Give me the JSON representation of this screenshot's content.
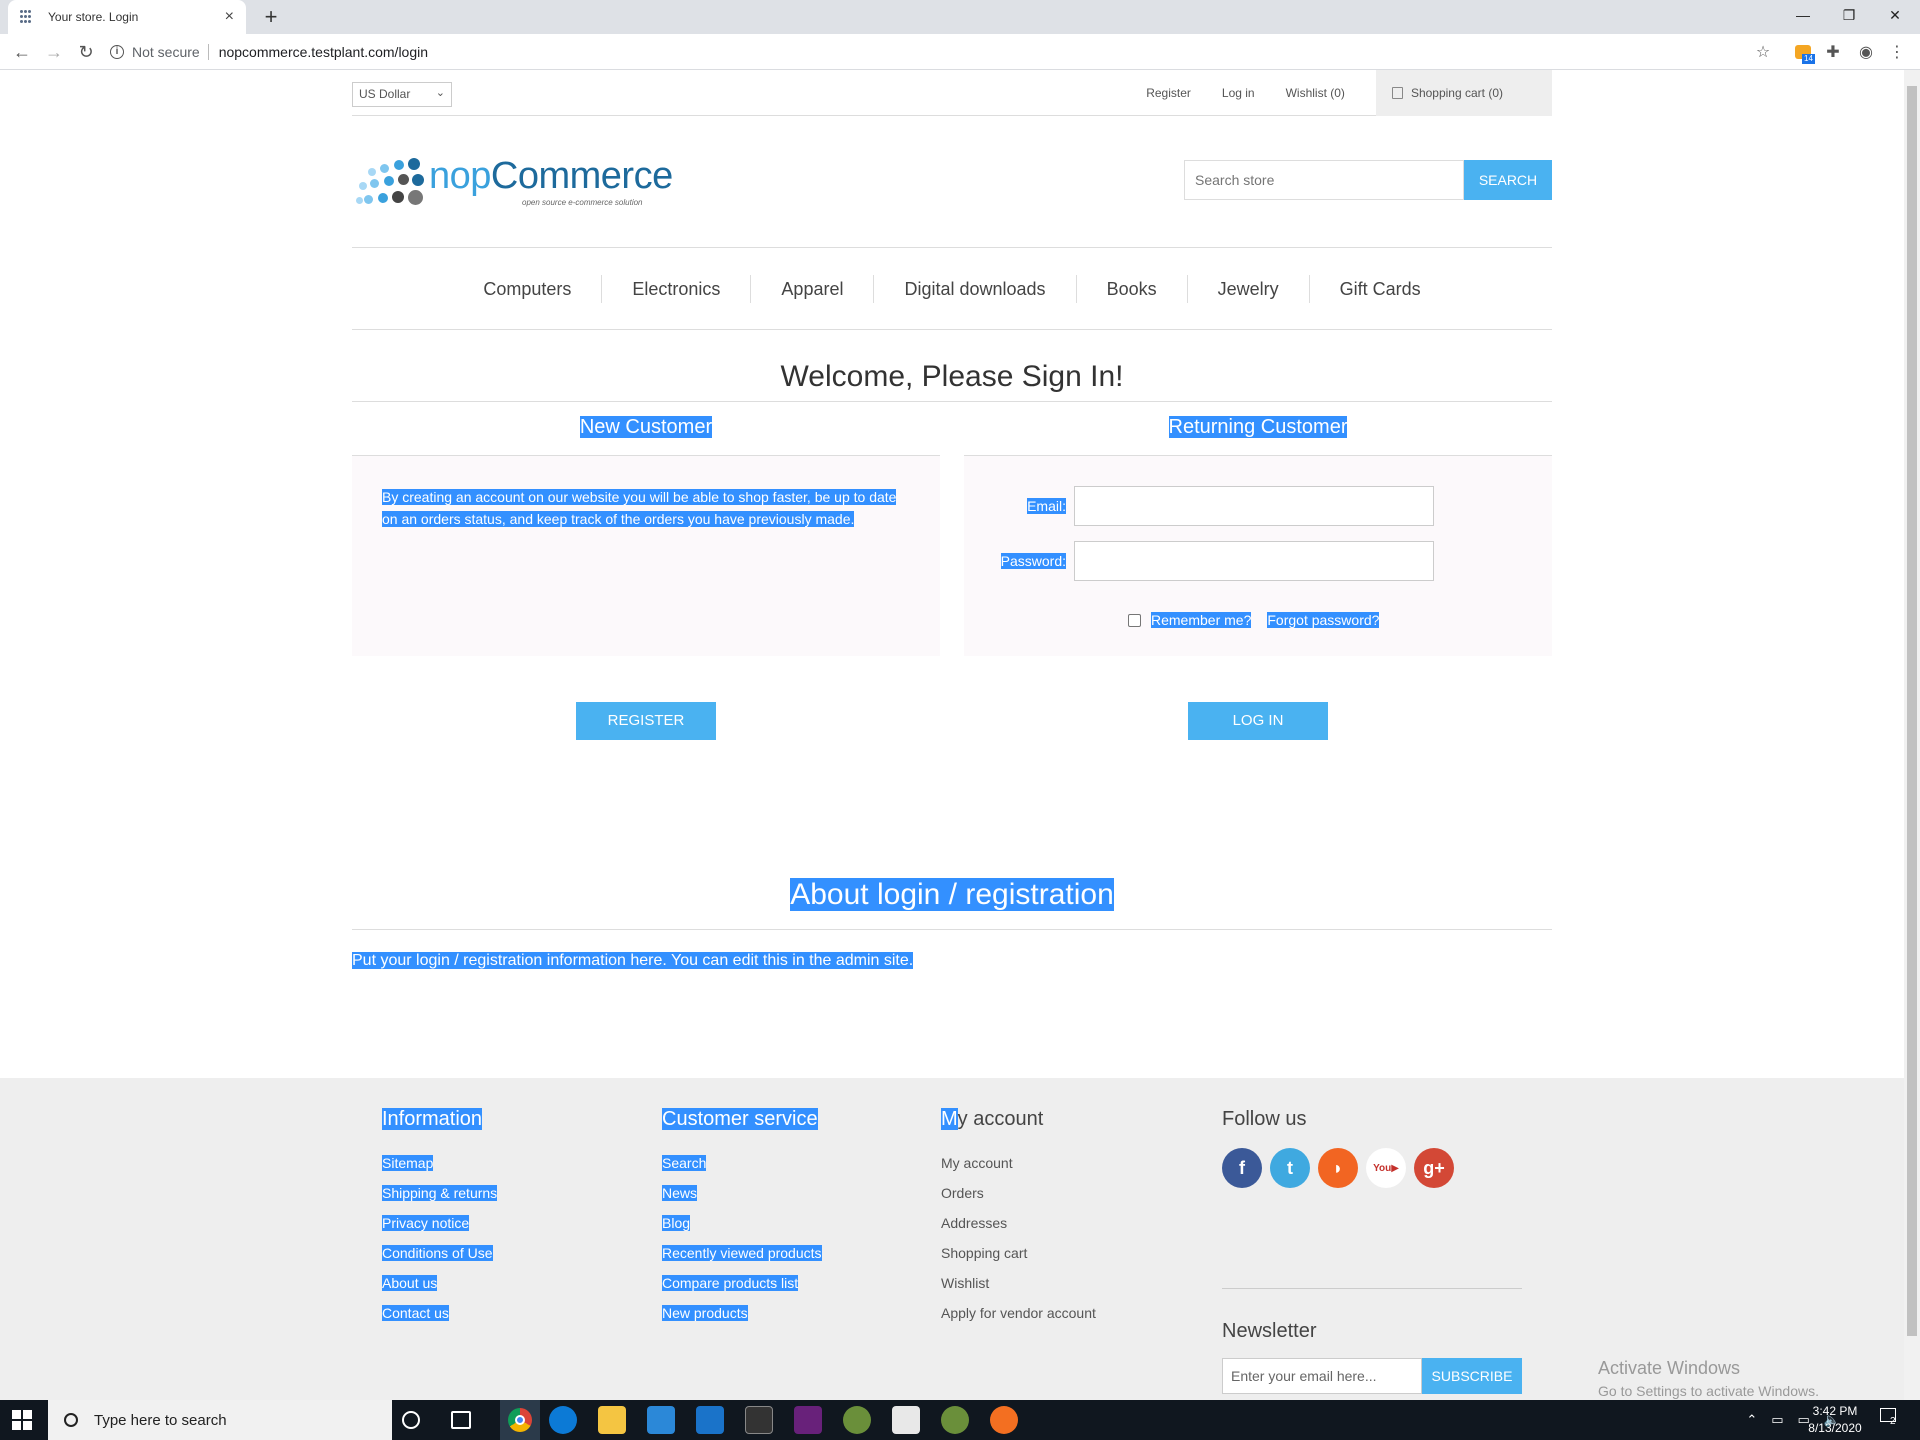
{
  "browser": {
    "tab_title": "Your store. Login",
    "tab_close": "×",
    "new_tab": "+",
    "security_label": "Not secure",
    "url": "nopcommerce.testplant.com/login",
    "extension_badge": "14"
  },
  "header": {
    "currency": "US Dollar",
    "links": {
      "register": "Register",
      "login": "Log in",
      "wishlist": "Wishlist (0)",
      "cart": "Shopping cart (0)"
    }
  },
  "logo": {
    "text_a": "nop",
    "text_b": "Commerce",
    "tagline": "open source e-commerce solution"
  },
  "search": {
    "placeholder": "Search store",
    "button": "SEARCH"
  },
  "menu": [
    "Computers",
    "Electronics",
    "Apparel",
    "Digital downloads",
    "Books",
    "Jewelry",
    "Gift Cards"
  ],
  "page": {
    "title": "Welcome, Please Sign In!",
    "new_customer": {
      "title": "New Customer",
      "text_line1": "By creating an account on our website you will be able to shop faster, be up to date",
      "text_line2": "on an orders status, and keep track of the orders you have previously made.",
      "button": "REGISTER"
    },
    "returning_customer": {
      "title": "Returning Customer",
      "email_label": "Email:",
      "password_label": "Password:",
      "email_value": "",
      "password_value": "",
      "remember_label": "Remember me?",
      "forgot_label": "Forgot password?",
      "button": "LOG IN"
    },
    "about": {
      "title": "About login / registration",
      "text": "Put your login / registration information here. You can edit this in the admin site."
    }
  },
  "footer": {
    "information": {
      "title": "Information",
      "items": [
        "Sitemap",
        "Shipping & returns",
        "Privacy notice",
        "Conditions of Use",
        "About us",
        "Contact us"
      ]
    },
    "customer_service": {
      "title": "Customer service",
      "items": [
        "Search",
        "News",
        "Blog",
        "Recently viewed products",
        "Compare products list",
        "New products"
      ]
    },
    "my_account": {
      "title_first": "M",
      "title_rest": "y account",
      "items": [
        "My account",
        "Orders",
        "Addresses",
        "Shopping cart",
        "Wishlist",
        "Apply for vendor account"
      ]
    },
    "follow": {
      "title": "Follow us",
      "networks": [
        "facebook-icon",
        "twitter-icon",
        "rss-icon",
        "youtube-icon",
        "google-plus-icon"
      ]
    },
    "newsletter": {
      "title": "Newsletter",
      "placeholder": "Enter your email here...",
      "button": "SUBSCRIBE"
    }
  },
  "watermark": {
    "line1": "Activate Windows",
    "line2": "Go to Settings to activate Windows."
  },
  "taskbar": {
    "search_placeholder": "Type here to search",
    "time": "3:42 PM",
    "date": "8/13/2020",
    "notifications": "2"
  },
  "colors": {
    "accent": "#4ab2f1",
    "selection": "#3390ff",
    "footer_bg": "#eeeeee",
    "taskbar_bg": "#10171f"
  }
}
